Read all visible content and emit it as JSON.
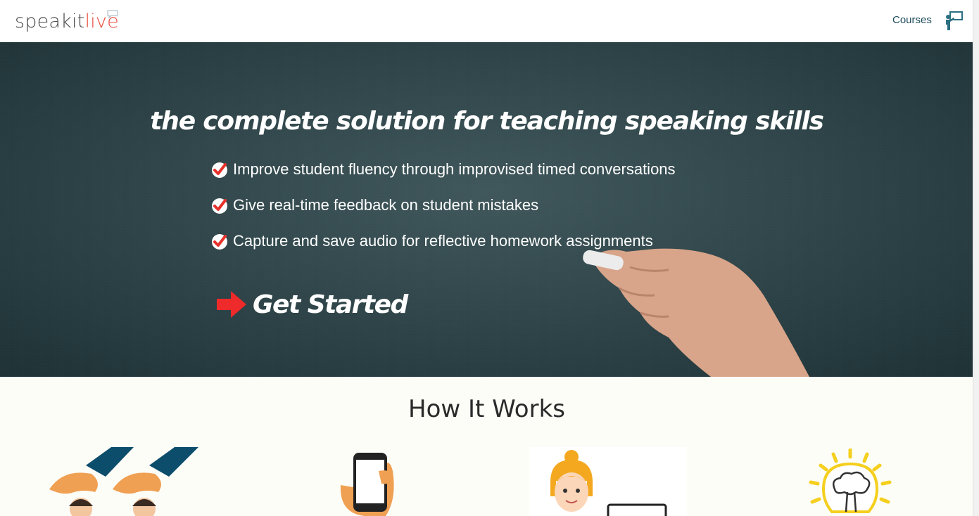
{
  "header": {
    "logo_part1": "speakit",
    "logo_part2": "live",
    "nav_courses": "Courses"
  },
  "hero": {
    "headline": "the complete solution for teaching speaking skills",
    "features": [
      "Improve student fluency through improvised timed conversations",
      "Give real-time feedback on student mistakes",
      "Capture and save audio for reflective homework assignments"
    ],
    "cta_label": "Get Started"
  },
  "how_it_works": {
    "title": "How It Works"
  },
  "colors": {
    "accent_red": "#e74c3c",
    "arrow_red": "#ee2a2a",
    "nav_teal": "#1d4c5c",
    "chalkboard": "#31474b"
  },
  "icons": {
    "logo_bubble": "speech-bubble-icon",
    "nav_icon": "teacher-at-board-icon",
    "feature_check": "check-badge-icon",
    "cta_arrow": "arrow-right-icon"
  }
}
